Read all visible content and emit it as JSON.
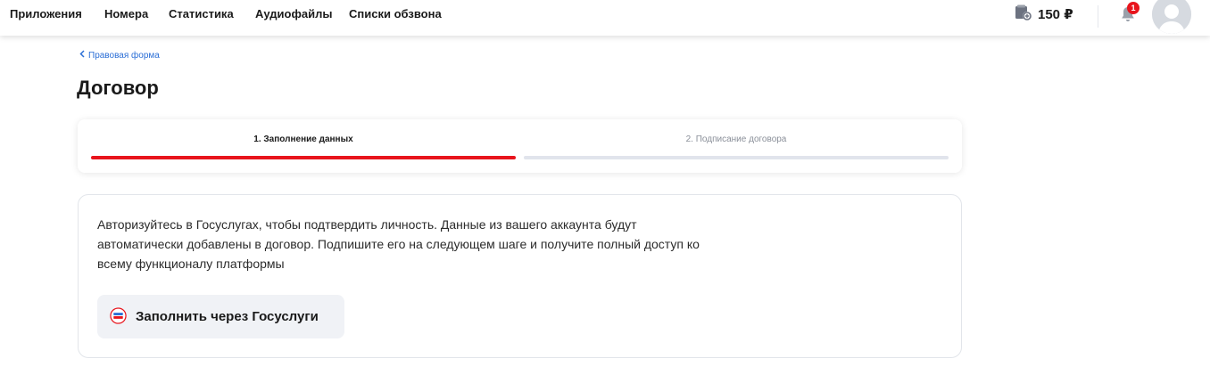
{
  "nav": {
    "items": [
      {
        "label": "Приложения"
      },
      {
        "label": "Номера"
      },
      {
        "label": "Статистика"
      },
      {
        "label": "Аудиофайлы"
      },
      {
        "label": "Списки обзвона"
      }
    ]
  },
  "header": {
    "balance": "150 ₽",
    "balance_icon": "wallet-icon",
    "notifications_count": "1",
    "notifications_icon": "bell-icon",
    "avatar_icon": "user-avatar-icon"
  },
  "breadcrumb": {
    "back_label": "Правовая форма",
    "icon": "chevron-left-icon"
  },
  "page": {
    "title": "Договор"
  },
  "steps": [
    {
      "label": "1. Заполнение данных",
      "active": true
    },
    {
      "label": "2. Подписание договора",
      "active": false
    }
  ],
  "info": {
    "text": "Авторизуйтесь в Госуслугах, чтобы подтвердить личность. Данные из вашего аккаунта будут автоматически добавлены в договор. Подпишите его на следующем шаге и получите полный доступ ко всему функционалу платформы",
    "button_label": "Заполнить через Госуслуги",
    "button_icon": "gosuslugi-icon"
  },
  "colors": {
    "accent": "#e8141c",
    "link": "#2c6fd6",
    "inactive_step": "#e1e4ec",
    "button_bg": "#f0f2f6"
  }
}
